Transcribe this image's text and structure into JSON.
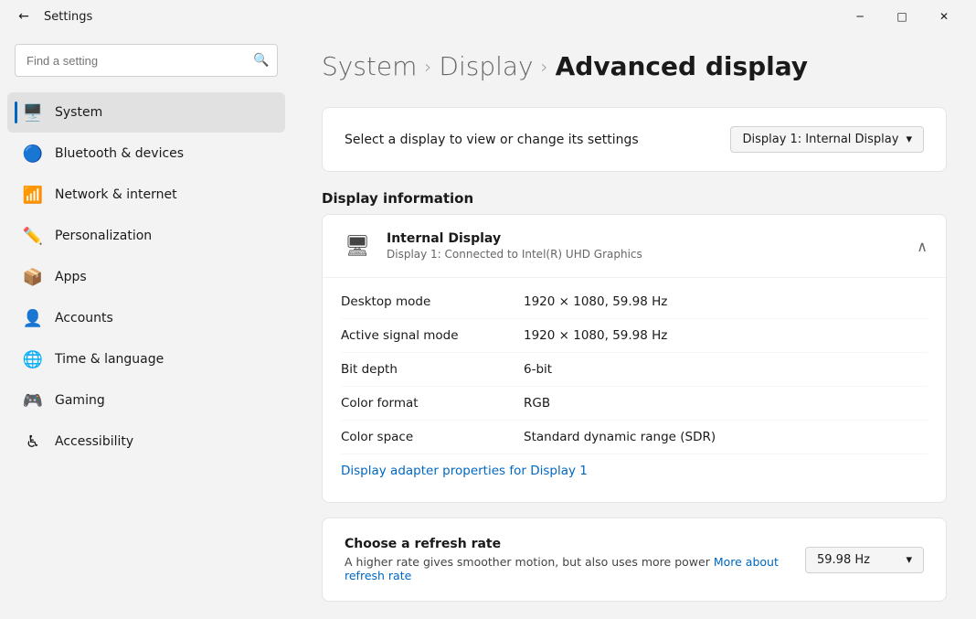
{
  "titlebar": {
    "back_label": "←",
    "title": "Settings",
    "minimize_label": "─",
    "maximize_label": "□",
    "close_label": "✕"
  },
  "search": {
    "placeholder": "Find a setting",
    "icon": "🔍"
  },
  "nav": {
    "items": [
      {
        "id": "system",
        "label": "System",
        "icon": "🖥️",
        "active": true
      },
      {
        "id": "bluetooth",
        "label": "Bluetooth & devices",
        "icon": "🔵"
      },
      {
        "id": "network",
        "label": "Network & internet",
        "icon": "📶"
      },
      {
        "id": "personalization",
        "label": "Personalization",
        "icon": "✏️"
      },
      {
        "id": "apps",
        "label": "Apps",
        "icon": "📦"
      },
      {
        "id": "accounts",
        "label": "Accounts",
        "icon": "👤"
      },
      {
        "id": "time",
        "label": "Time & language",
        "icon": "🌐"
      },
      {
        "id": "gaming",
        "label": "Gaming",
        "icon": "🎮"
      },
      {
        "id": "accessibility",
        "label": "Accessibility",
        "icon": "♿"
      }
    ]
  },
  "breadcrumb": {
    "parts": [
      "System",
      "Display"
    ],
    "current": "Advanced display"
  },
  "display_selector": {
    "label": "Select a display to view or change its settings",
    "selected": "Display 1: Internal Display",
    "chevron": "▾"
  },
  "display_info": {
    "section_title": "Display information",
    "display_name": "Internal Display",
    "display_subtitle": "Display 1: Connected to Intel(R) UHD Graphics",
    "collapse_icon": "∧",
    "rows": [
      {
        "label": "Desktop mode",
        "value": "1920 × 1080, 59.98 Hz"
      },
      {
        "label": "Active signal mode",
        "value": "1920 × 1080, 59.98 Hz"
      },
      {
        "label": "Bit depth",
        "value": "6-bit"
      },
      {
        "label": "Color format",
        "value": "RGB"
      },
      {
        "label": "Color space",
        "value": "Standard dynamic range (SDR)"
      }
    ],
    "adapter_link": "Display adapter properties for Display 1"
  },
  "refresh_rate": {
    "title": "Choose a refresh rate",
    "description": "A higher rate gives smoother motion, but also uses more power",
    "link_text": "More about refresh rate",
    "selected": "59.98 Hz",
    "chevron": "▾"
  }
}
